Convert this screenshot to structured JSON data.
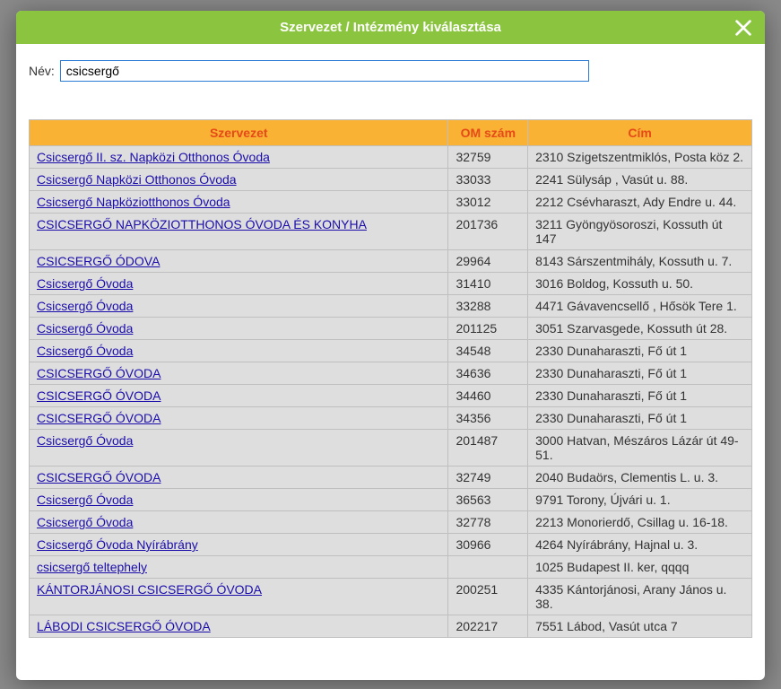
{
  "dialog": {
    "title": "Szervezet / Intézmény kiválasztása"
  },
  "filter": {
    "label": "Név:",
    "value": "csicsergő"
  },
  "table": {
    "headers": {
      "org": "Szervezet",
      "om": "OM szám",
      "addr": "Cím"
    },
    "rows": [
      {
        "org": "Csicsergő II. sz. Napközi Otthonos Óvoda",
        "om": "32759",
        "addr": "2310 Szigetszentmiklós, Posta köz 2."
      },
      {
        "org": "Csicsergő Napközi Otthonos Óvoda",
        "om": "33033",
        "addr": "2241 Sülysáp , Vasút u. 88."
      },
      {
        "org": "Csicsergő Napköziotthonos Óvoda",
        "om": "33012",
        "addr": "2212 Csévharaszt, Ady Endre u. 44."
      },
      {
        "org": "CSICSERGŐ NAPKÖZIOTTHONOS ÓVODA ÉS KONYHA",
        "om": "201736",
        "addr": "3211 Gyöngyösoroszi, Kossuth út 147"
      },
      {
        "org": "CSICSERGŐ ÓDOVA",
        "om": "29964",
        "addr": "8143 Sárszentmihály, Kossuth u. 7."
      },
      {
        "org": "Csicsergő Óvoda",
        "om": "31410",
        "addr": "3016 Boldog, Kossuth u. 50."
      },
      {
        "org": "Csicsergő Óvoda",
        "om": "33288",
        "addr": "4471 Gávavencsellő , Hősök Tere 1."
      },
      {
        "org": "Csicsergő Óvoda",
        "om": "201125",
        "addr": "3051 Szarvasgede, Kossuth út 28."
      },
      {
        "org": "Csicsergő Óvoda",
        "om": "34548",
        "addr": "2330 Dunaharaszti, Fő út 1"
      },
      {
        "org": "CSICSERGŐ ÓVODA",
        "om": "34636",
        "addr": "2330 Dunaharaszti, Fő út 1"
      },
      {
        "org": "CSICSERGŐ ÓVODA",
        "om": "34460",
        "addr": "2330 Dunaharaszti, Fő út 1"
      },
      {
        "org": "CSICSERGŐ ÓVODA",
        "om": "34356",
        "addr": "2330 Dunaharaszti, Fő út 1"
      },
      {
        "org": "Csicsergő Óvoda",
        "om": "201487",
        "addr": "3000 Hatvan, Mészáros Lázár út 49-51."
      },
      {
        "org": "CSICSERGŐ ÓVODA",
        "om": "32749",
        "addr": "2040 Budaörs, Clementis L. u. 3."
      },
      {
        "org": "Csicsergő Óvoda",
        "om": "36563",
        "addr": "9791 Torony, Újvári u. 1."
      },
      {
        "org": "Csicsergő Óvoda",
        "om": "32778",
        "addr": "2213 Monorierdő, Csillag u. 16-18."
      },
      {
        "org": "Csicsergő Óvoda Nyírábrány",
        "om": "30966",
        "addr": "4264 Nyírábrány, Hajnal u. 3."
      },
      {
        "org": "csicsergő teltephely",
        "om": "",
        "addr": "1025 Budapest II. ker, qqqq"
      },
      {
        "org": "KÁNTORJÁNOSI CSICSERGŐ ÓVODA",
        "om": "200251",
        "addr": "4335 Kántorjánosi, Arany János u. 38."
      },
      {
        "org": "LÁBODI CSICSERGŐ ÓVODA",
        "om": "202217",
        "addr": "7551 Lábod, Vasút utca 7"
      }
    ]
  }
}
